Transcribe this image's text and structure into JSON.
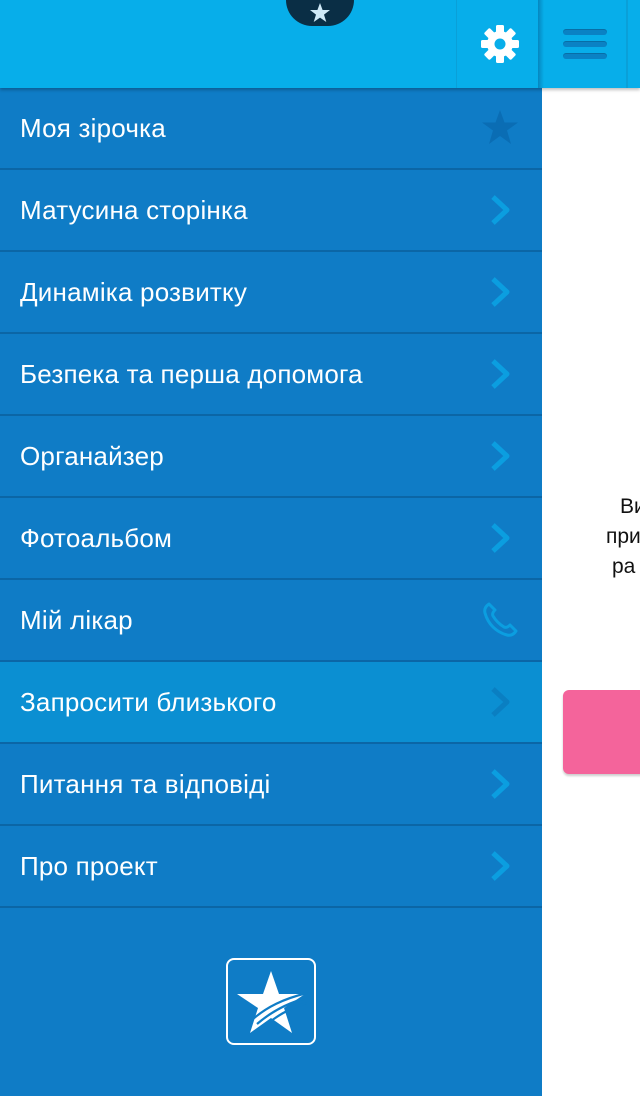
{
  "topbar": {
    "notch_icon": "star-icon",
    "settings_icon": "gear-icon",
    "menu_icon": "hamburger-icon"
  },
  "menu": {
    "items": [
      {
        "label": "Моя зірочка",
        "icon": "star-icon"
      },
      {
        "label": "Матусина сторінка",
        "icon": "chevron-right-icon"
      },
      {
        "label": "Динаміка розвитку",
        "icon": "chevron-right-icon"
      },
      {
        "label": "Безпека та перша допомога",
        "icon": "chevron-right-icon"
      },
      {
        "label": "Органайзер",
        "icon": "chevron-right-icon"
      },
      {
        "label": "Фотоальбом",
        "icon": "chevron-right-icon"
      },
      {
        "label": "Мій лікар",
        "icon": "phone-icon"
      },
      {
        "label": "Запросити близького",
        "icon": "chevron-right-icon",
        "active": true
      },
      {
        "label": "Питання та відповіді",
        "icon": "chevron-right-icon"
      },
      {
        "label": "Про проект",
        "icon": "chevron-right-icon"
      }
    ]
  },
  "logo": {
    "icon": "star-logo-icon"
  },
  "content": {
    "text_lines": [
      "Ви",
      "при",
      "ра"
    ]
  },
  "colors": {
    "topbar": "#07aeea",
    "menu_bg": "#0f7cc6",
    "menu_active": "#0b8fd2",
    "pink_button": "#f4649b"
  }
}
